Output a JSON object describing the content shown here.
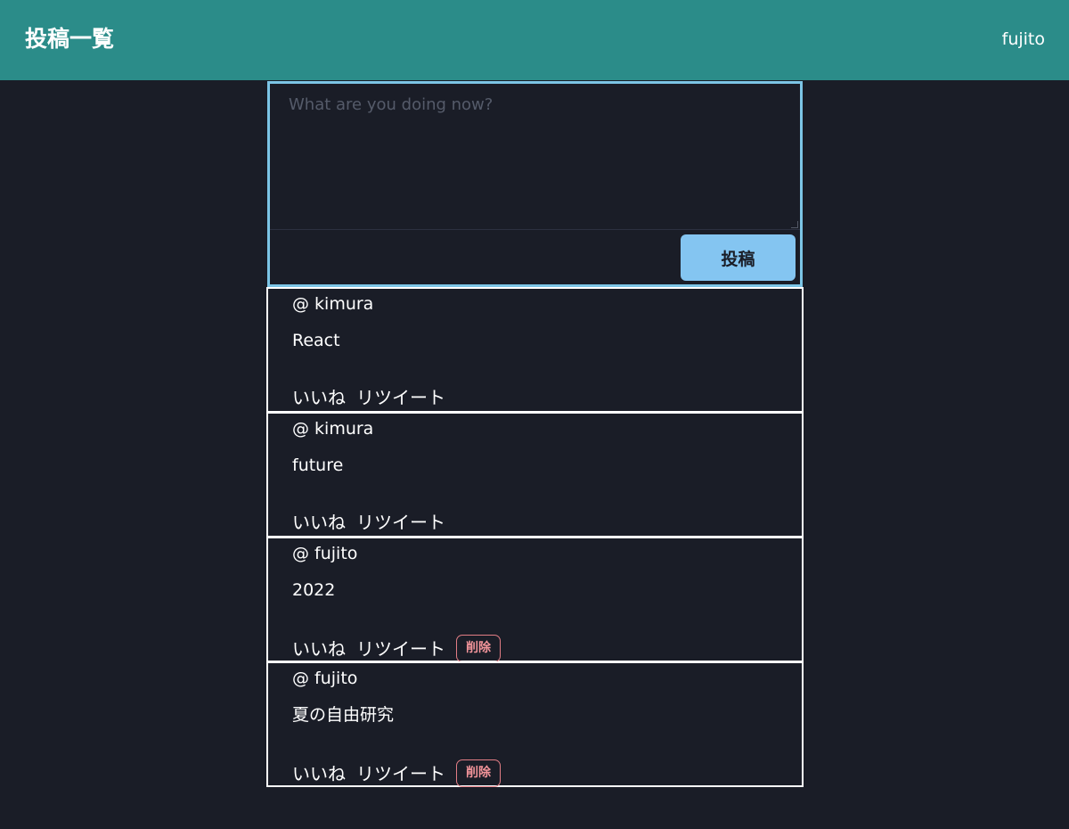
{
  "header": {
    "title": "投稿一覧",
    "username": "fujito"
  },
  "compose": {
    "placeholder": "What are you doing now?",
    "value": "",
    "submit_label": "投稿"
  },
  "posts": [
    {
      "user": "@ kimura",
      "body": "React",
      "like_label": "いいね",
      "retweet_label": "リツイート",
      "delete_label": ""
    },
    {
      "user": "@ kimura",
      "body": "future",
      "like_label": "いいね",
      "retweet_label": "リツイート",
      "delete_label": ""
    },
    {
      "user": "@ fujito",
      "body": "2022",
      "like_label": "いいね",
      "retweet_label": "リツイート",
      "delete_label": "削除"
    },
    {
      "user": "@ fujito",
      "body": "夏の自由研究",
      "like_label": "いいね",
      "retweet_label": "リツイート",
      "delete_label": "削除"
    }
  ],
  "colors": {
    "header_bg": "#2b8c89",
    "page_bg": "#1a1d27",
    "accent": "#84c5f1",
    "compose_border": "#7cc5e6",
    "delete": "#e27d85"
  }
}
